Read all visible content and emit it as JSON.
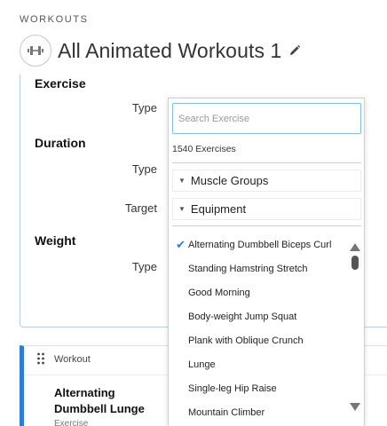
{
  "header": {
    "section_label": "WORKOUTS",
    "title": "All Animated Workouts 1"
  },
  "form": {
    "exercise_heading": "Exercise",
    "exercise_type_label": "Type",
    "duration_heading": "Duration",
    "duration_type_label": "Type",
    "duration_target_label": "Target",
    "weight_heading": "Weight",
    "weight_type_label": "Type"
  },
  "dropdown": {
    "search_placeholder": "Search Exercise",
    "search_value": "",
    "count_text": "1540 Exercises",
    "filters": [
      {
        "label": "Muscle Groups"
      },
      {
        "label": "Equipment"
      }
    ],
    "items": [
      {
        "label": "Alternating Dumbbell Biceps Curl",
        "selected": true
      },
      {
        "label": "Standing Hamstring Stretch",
        "selected": false
      },
      {
        "label": "Good Morning",
        "selected": false
      },
      {
        "label": "Body-weight Jump Squat",
        "selected": false
      },
      {
        "label": "Plank with Oblique Crunch",
        "selected": false
      },
      {
        "label": "Lunge",
        "selected": false
      },
      {
        "label": "Single-leg Hip Raise",
        "selected": false
      },
      {
        "label": "Mountain Climber",
        "selected": false
      }
    ]
  },
  "workout_card": {
    "label": "Workout",
    "name_line1": "Alternating",
    "name_line2": "Dumbbell Lunge",
    "sub": "Exercise"
  },
  "colors": {
    "accent": "#2d7dd2",
    "panel_border": "#b9cfe3",
    "search_focus_border": "#7fbfe8"
  },
  "icons": {
    "title_icon": "dumbbell-icon",
    "edit_icon": "pencil-icon",
    "check_icon": "checkmark-icon",
    "drag_icon": "drag-handle-icon",
    "filter_caret": "caret-down-icon"
  }
}
